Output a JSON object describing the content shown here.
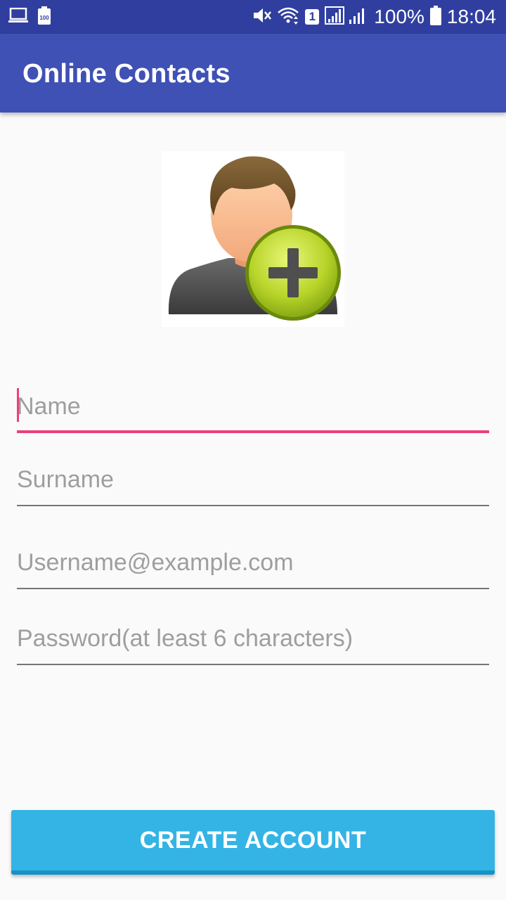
{
  "status_bar": {
    "left_icons": [
      "laptop-icon",
      "battery-saver-icon"
    ],
    "right_icons": [
      "mute-icon",
      "wifi-icon",
      "signal-icon"
    ],
    "sim_slot": "1",
    "battery_percent": "100%",
    "time": "18:04"
  },
  "app_bar": {
    "title": "Online Contacts"
  },
  "avatar": {
    "icon": "add-contact-icon"
  },
  "form": {
    "name_placeholder": "Name",
    "surname_placeholder": "Surname",
    "email_placeholder": "Username@example.com",
    "password_placeholder": "Password(at least 6 characters)"
  },
  "create_button": {
    "label": "CREATE ACCOUNT"
  },
  "colors": {
    "status_bar": "#303f9f",
    "app_bar": "#3f51b5",
    "accent": "#ec407a",
    "button": "#34b4e4",
    "background": "#fafafa"
  }
}
